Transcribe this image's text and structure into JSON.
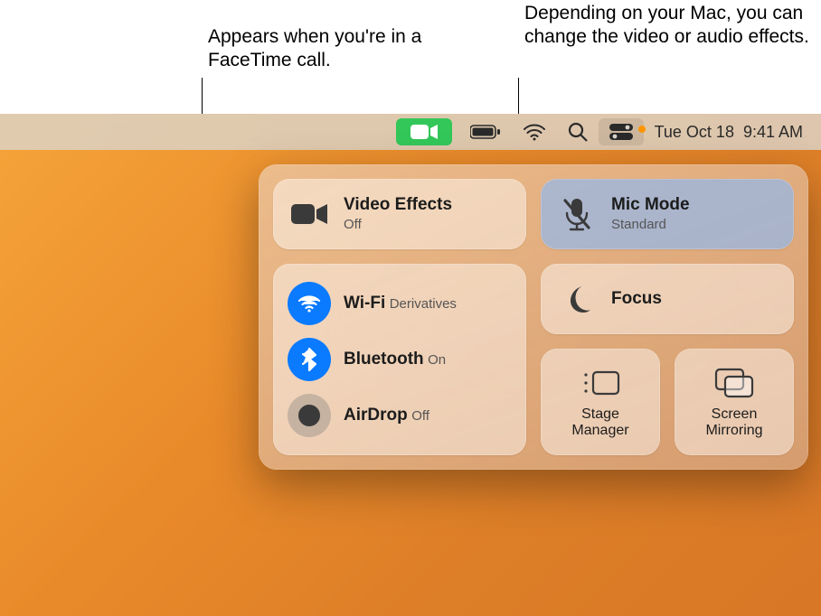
{
  "callouts": {
    "facetime": "Appears when you're in a FaceTime call.",
    "effects": "Depending on your Mac, you can change the video or audio effects."
  },
  "menubar": {
    "datetime_date": "Tue Oct 18",
    "datetime_time": "9:41 AM"
  },
  "cc": {
    "video_effects": {
      "title": "Video Effects",
      "sub": "Off"
    },
    "mic_mode": {
      "title": "Mic Mode",
      "sub": "Standard"
    },
    "wifi": {
      "title": "Wi-Fi",
      "sub": "Derivatives"
    },
    "bluetooth": {
      "title": "Bluetooth",
      "sub": "On"
    },
    "airdrop": {
      "title": "AirDrop",
      "sub": "Off"
    },
    "focus": {
      "title": "Focus"
    },
    "stage": {
      "label": "Stage\nManager"
    },
    "mirror": {
      "label": "Screen\nMirroring"
    }
  },
  "colors": {
    "facetime_green": "#33c759",
    "ios_blue": "#0a7aff",
    "orange_indicator": "#ff9500"
  }
}
